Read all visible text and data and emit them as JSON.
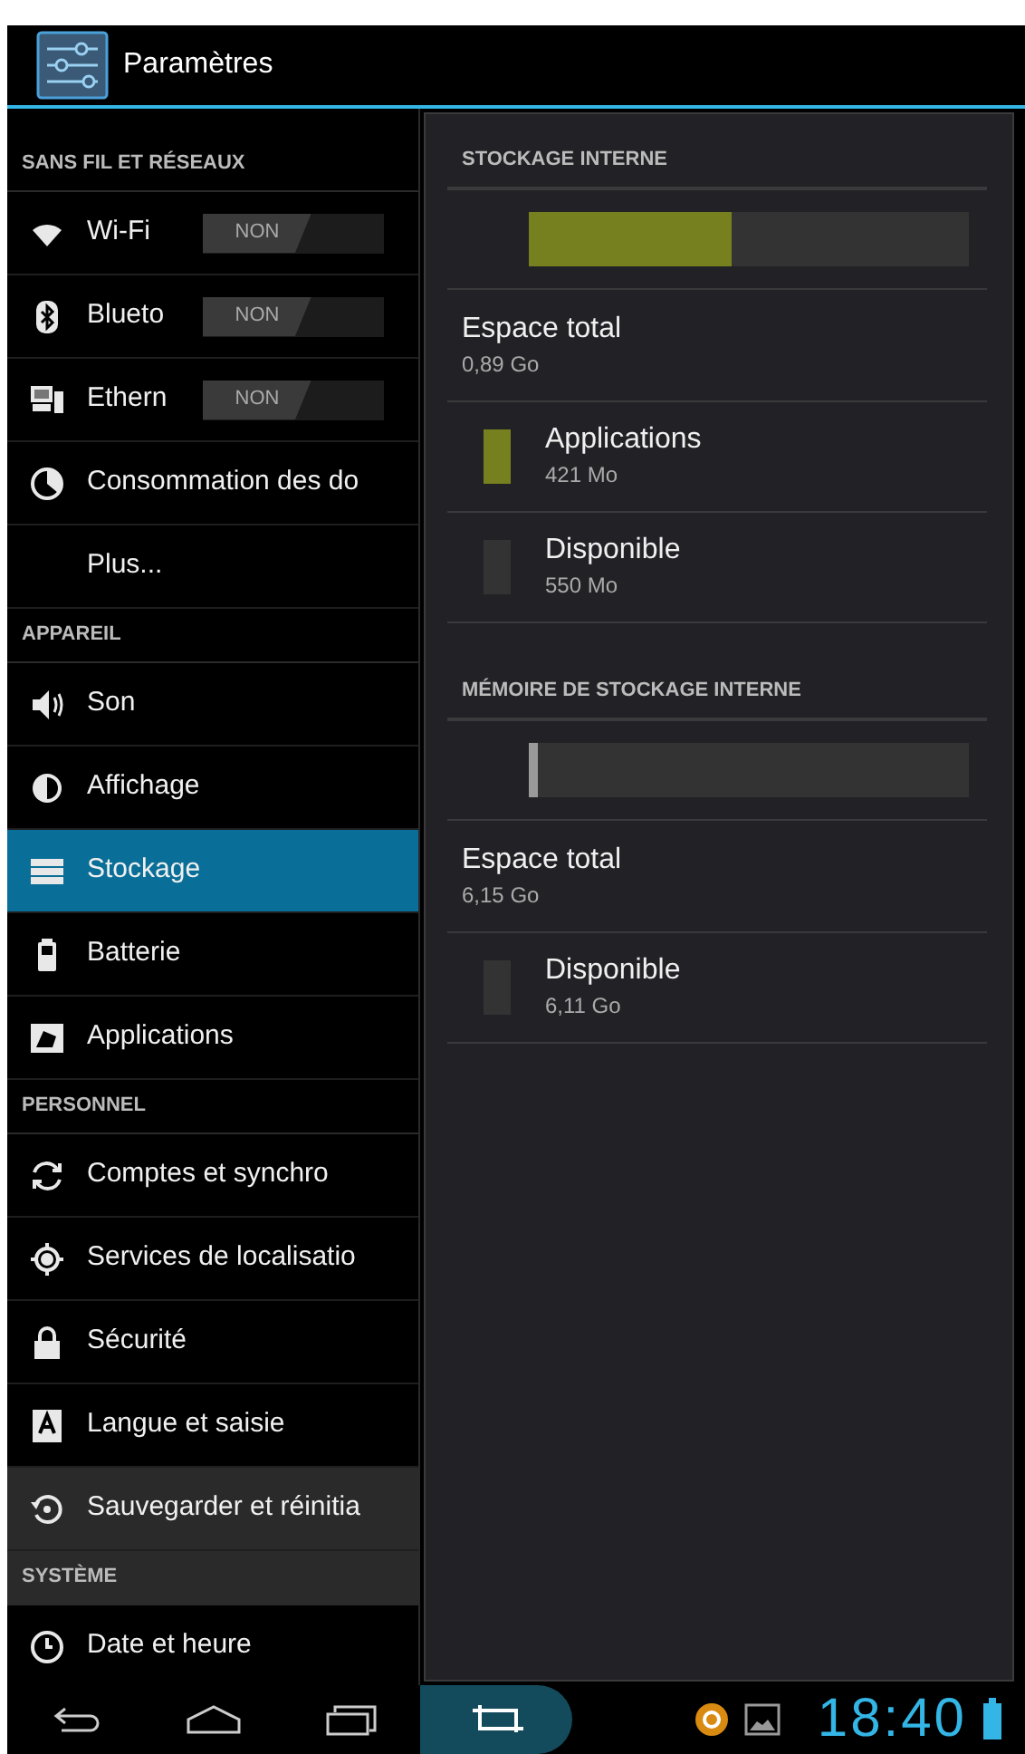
{
  "action_bar": {
    "title": "Paramètres"
  },
  "sidebar": [
    {
      "kind": "header",
      "label": "SANS FIL ET RÉSEAUX",
      "focused": false
    },
    {
      "kind": "toggle",
      "label": "Wi-Fi",
      "switch_label": "NON",
      "on": false,
      "selected": false,
      "focused": false
    },
    {
      "kind": "toggle",
      "label": "Blueto",
      "switch_label": "NON",
      "on": false,
      "selected": false,
      "focused": false
    },
    {
      "kind": "toggle",
      "label": "Ethern",
      "switch_label": "NON",
      "on": false,
      "selected": false,
      "focused": false
    },
    {
      "kind": "item",
      "label": "Consommation des do",
      "selected": false,
      "focused": false
    },
    {
      "kind": "item",
      "label": "Plus...",
      "selected": false,
      "focused": false
    },
    {
      "kind": "header",
      "label": "APPAREIL",
      "focused": false
    },
    {
      "kind": "item",
      "label": "Son",
      "selected": false,
      "focused": false
    },
    {
      "kind": "item",
      "label": "Affichage",
      "selected": false,
      "focused": false
    },
    {
      "kind": "item",
      "label": "Stockage",
      "selected": true,
      "focused": false
    },
    {
      "kind": "item",
      "label": "Batterie",
      "selected": false,
      "focused": false
    },
    {
      "kind": "item",
      "label": "Applications",
      "selected": false,
      "focused": false
    },
    {
      "kind": "header",
      "label": "PERSONNEL",
      "focused": false
    },
    {
      "kind": "item",
      "label": "Comptes et synchro",
      "selected": false,
      "focused": false
    },
    {
      "kind": "item",
      "label": "Services de localisatio",
      "selected": false,
      "focused": false
    },
    {
      "kind": "item",
      "label": "Sécurité",
      "selected": false,
      "focused": false
    },
    {
      "kind": "item",
      "label": "Langue et saisie",
      "selected": false,
      "focused": false
    },
    {
      "kind": "item",
      "label": "Sauvegarder et réinitia",
      "selected": false,
      "focused": true
    },
    {
      "kind": "header",
      "label": "SYSTÈME",
      "focused": true
    },
    {
      "kind": "item",
      "label": "Date et heure",
      "selected": false,
      "focused": false
    }
  ],
  "storage_sections": [
    {
      "title": "STOCKAGE INTERNE",
      "bar": [
        {
          "level": 0.46,
          "color": "#76801e"
        }
      ],
      "total": {
        "label": "Espace total",
        "value": "0,89 Go"
      },
      "legend": [
        {
          "label": "Applications",
          "value": "421 Mo",
          "color": "#76801e"
        },
        {
          "label": "Disponible",
          "value": "550 Mo",
          "color": "#333333"
        }
      ]
    },
    {
      "title": "MÉMOIRE DE STOCKAGE INTERNE",
      "bar": [
        {
          "level": 0.02,
          "color": "#9a9a9a"
        }
      ],
      "total": {
        "label": "Espace total",
        "value": "6,15 Go"
      },
      "legend": [
        {
          "label": "Disponible",
          "value": "6,11 Go",
          "color": "#333333"
        }
      ]
    }
  ],
  "status_bar": {
    "time": "18:40"
  }
}
